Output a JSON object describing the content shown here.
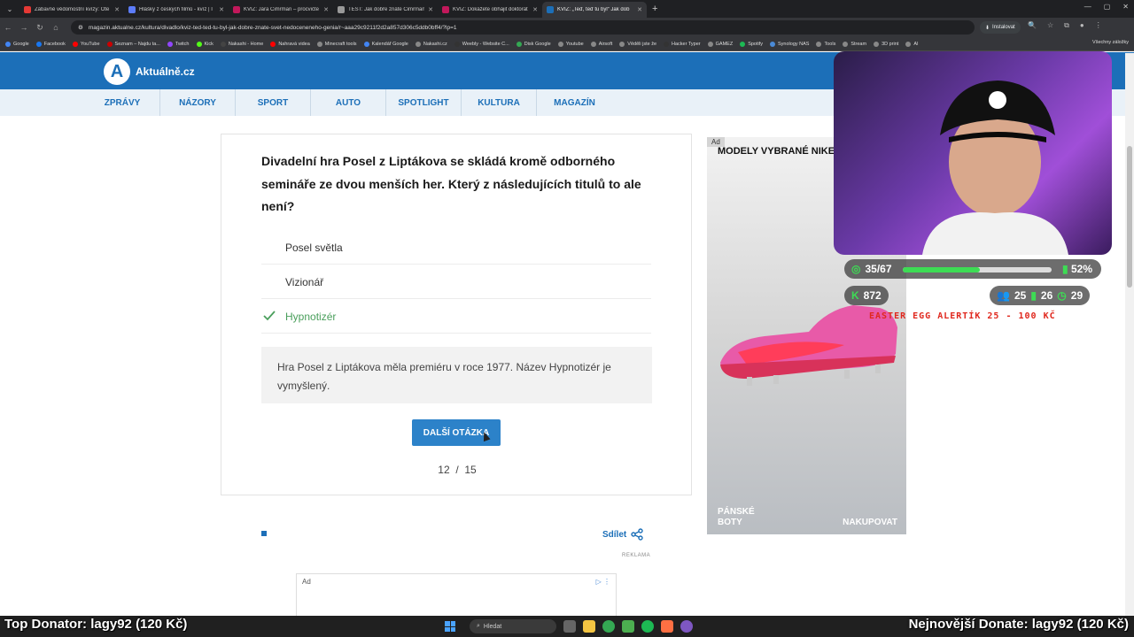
{
  "browser": {
    "tabs": [
      {
        "title": "Zábavné vědomostní kvízy: Ote",
        "color": "#e53935",
        "active": false
      },
      {
        "title": "Hlášky z českých filmů - kvíz | I",
        "color": "#5c7cfa",
        "active": false
      },
      {
        "title": "KVÍZ: Jára Cimrman – procvičte",
        "color": "#c2185b",
        "active": false
      },
      {
        "title": "TEST: Jak dobře znáte Cimrmana",
        "color": "#999999",
        "active": false
      },
      {
        "title": "KVÍZ: Dokážete obhájit doktorát",
        "color": "#c2185b",
        "active": false
      },
      {
        "title": "KVÍZ: „Teď, teď tu byl“ Jak dob",
        "color": "#1c6fb8",
        "active": true
      }
    ],
    "url": "magazin.aktualne.cz/kultura/divadlo/kviz-ted-ted-tu-byl-jak-dobre-znate-svet-nedoceneneho-genia/r~aaa29c9211f2d2a857d306c5ddb0bff4/?lp=1",
    "install_label": "Instalovat",
    "bookmarks": [
      {
        "label": "Google",
        "color": "#4285f4"
      },
      {
        "label": "Facebook",
        "color": "#1877f2"
      },
      {
        "label": "YouTube",
        "color": "#ff0000"
      },
      {
        "label": "Seznam – Najdu ta...",
        "color": "#cc0000"
      },
      {
        "label": "Twitch",
        "color": "#9146ff"
      },
      {
        "label": "Kick",
        "color": "#53fc18"
      },
      {
        "label": "Nakashi - Home",
        "color": "#444444"
      },
      {
        "label": "Nahravá videa",
        "color": "#ff0000"
      },
      {
        "label": "Minecraft tools",
        "color": "#888888"
      },
      {
        "label": "Kalendář Google",
        "color": "#4285f4"
      },
      {
        "label": "Nakashi.cz",
        "color": "#888888"
      },
      {
        "label": "Weebly - Website C...",
        "color": "#333333"
      },
      {
        "label": "Disk Google",
        "color": "#34a853"
      },
      {
        "label": "Youtube",
        "color": "#888888"
      },
      {
        "label": "Airsoft",
        "color": "#888888"
      },
      {
        "label": "Věděli jste že",
        "color": "#888888"
      },
      {
        "label": "Hacker Typer",
        "color": "#333333"
      },
      {
        "label": "GAMEZ",
        "color": "#888888"
      },
      {
        "label": "Spotify",
        "color": "#1db954"
      },
      {
        "label": "Synology NAS",
        "color": "#4a8ad6"
      },
      {
        "label": "Tools",
        "color": "#888888"
      },
      {
        "label": "Stream",
        "color": "#888888"
      },
      {
        "label": "3D print",
        "color": "#888888"
      },
      {
        "label": "AI",
        "color": "#888888"
      }
    ],
    "all_bookmarks_label": "Všechny záložky"
  },
  "site": {
    "logo_mark": "A",
    "logo_text": "Aktuálně.cz",
    "nav": [
      "ZPRÁVY",
      "NÁZORY",
      "SPORT",
      "AUTO",
      "SPOTLIGHT",
      "KULTURA",
      "MAGAZÍN"
    ]
  },
  "quiz": {
    "question": "Divadelní hra Posel z Liptákova se skládá kromě odborného semináře ze dvou menších her. Který z následujících titulů to ale není?",
    "answers": [
      {
        "text": "Posel světla",
        "correct": false
      },
      {
        "text": "Vizionář",
        "correct": false
      },
      {
        "text": "Hypnotizér",
        "correct": true
      }
    ],
    "explanation": "Hra Posel z Liptákova měla premiéru v roce 1977. Název Hypnotizér je vymyšlený.",
    "next_label": "DALŠÍ OTÁZKA",
    "current": "12",
    "separator": "/",
    "total": "15"
  },
  "share_label": "Sdílet",
  "reklama_label": "REKLAMA",
  "bottom_ad": {
    "label": "Ad"
  },
  "side_ad": {
    "ad_label": "Ad",
    "headline": "MODELY VYBRANÉ NIKE",
    "footer_left": "PÁNSKÉ BOTY",
    "footer_right": "NAKUPOVAT"
  },
  "stream": {
    "progress_text": "35/67",
    "progress_value": 0.52,
    "percent_text": "52%",
    "kick_count": "872",
    "stat1": "25",
    "stat2": "26",
    "stat3": "29",
    "easter_egg": "EASTER EGG ALERTÍK 25 - 100 KČ",
    "top_donator": "Top Donator: lagy92 (120 Kč)",
    "newest_donate": "Nejnovější Donate: lagy92 (120 Kč)"
  },
  "taskbar": {
    "search_placeholder": "Hledat"
  }
}
